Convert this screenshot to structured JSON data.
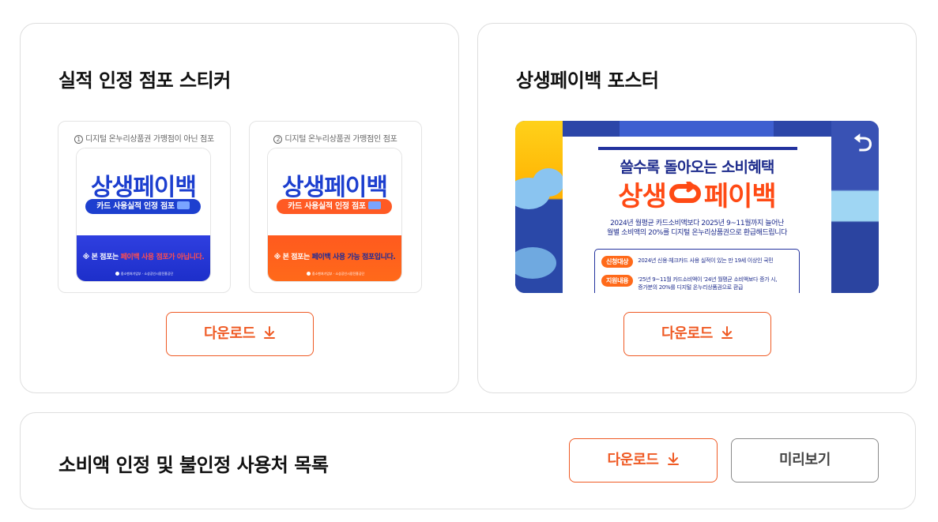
{
  "sticker_card": {
    "title": "실적 인정 점포 스티커",
    "stickers": [
      {
        "number": "1",
        "caption": "디지털 온누리상품권 가맹점이 아닌 점포",
        "brand": "상생페이백",
        "pill": "카드 사용실적 인정 점포",
        "notice_prefix": "※ 본 점포는 ",
        "notice_highlight": "페이백 사용 점포가 아닙니다.",
        "logos": "중소벤처기업부 · 소상공인시장진흥공단"
      },
      {
        "number": "2",
        "caption": "디지털 온누리상품권 가맹점인 점포",
        "brand": "상생페이백",
        "pill": "카드 사용실적 인정 점포",
        "notice_prefix": "※ 본 점포는 ",
        "notice_highlight": "페이백 사용 가능 점포입니다.",
        "logos": "중소벤처기업부 · 소상공인시장진흥공단"
      }
    ],
    "download_label": "다운로드"
  },
  "poster_card": {
    "title": "상생페이백 포스터",
    "poster": {
      "headline": "쓸수록 돌아오는 소비혜택",
      "brand_left": "상생",
      "brand_right": "페이백",
      "desc_line1": "2024년 월평균 카드소비액보다 2025년 9~11월까지 늘어난",
      "desc_line2": "월별 소비액의 20%를 디지털 온누리상품권으로 환급해드립니다",
      "row1_tag": "신청대상",
      "row1_text": "2024년 신용·체크카드 사용 실적이 있는 만 19세 이상인 국민",
      "row2_tag": "지원내용",
      "row2_text_line1": "'25년 9~11월 카드소비액이 '24년 월평균 소비액보다 증가 시,",
      "row2_text_line2": "증가분의 20%를 디지털 온누리상품권으로 환급"
    },
    "download_label": "다운로드"
  },
  "list_card": {
    "title": "소비액 인정 및 불인정 사용처 목록",
    "download_label": "다운로드",
    "preview_label": "미리보기"
  },
  "icons": {
    "download": "download-arrow-icon",
    "return": "return-arrow-icon"
  },
  "colors": {
    "accent_orange": "#ef5a24",
    "brand_blue": "#1d3fcf",
    "border": "#dedede"
  }
}
